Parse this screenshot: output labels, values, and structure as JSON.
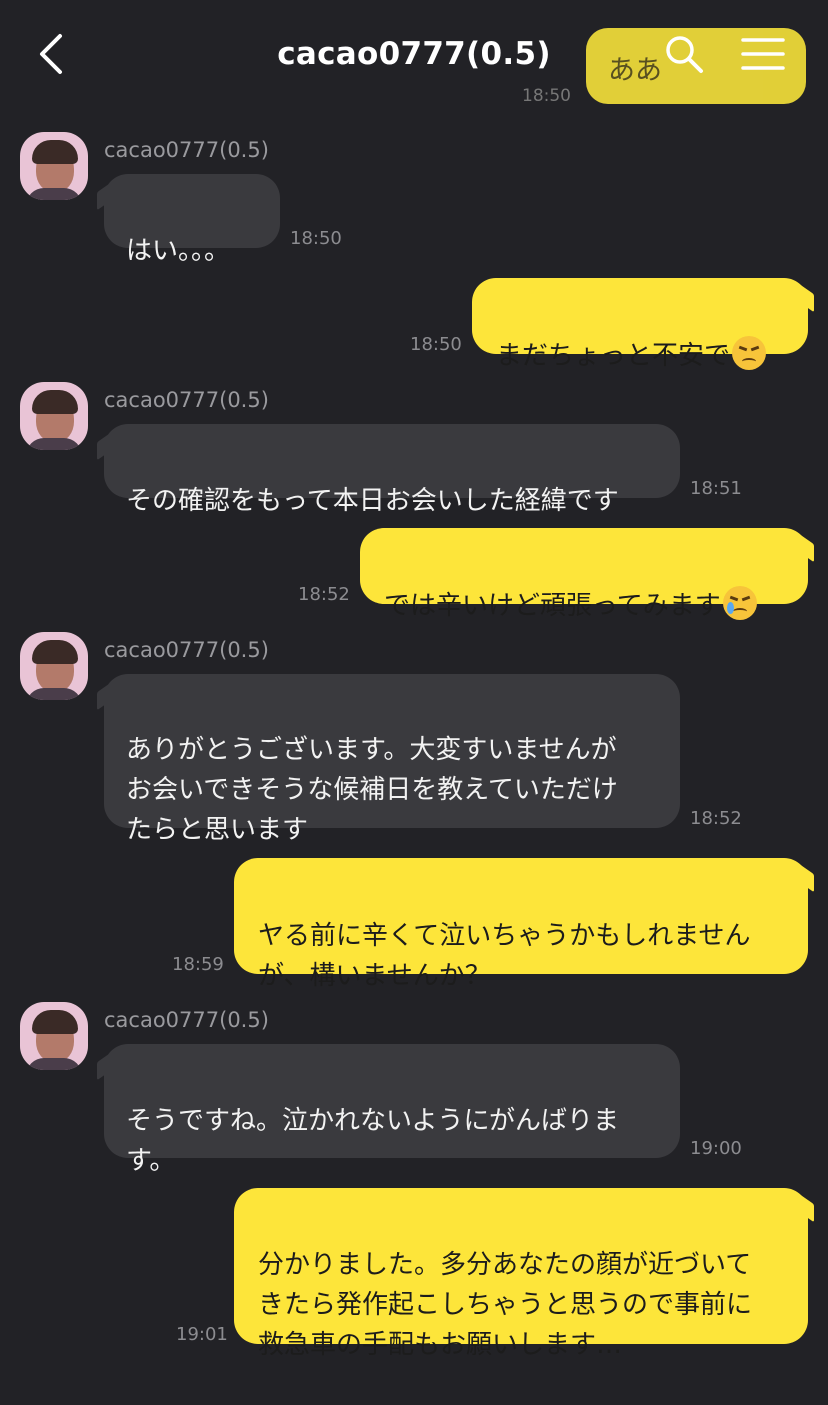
{
  "header": {
    "title": "cacao0777(0.5)",
    "back_icon": "chevron-left-icon",
    "search_icon": "search-icon",
    "menu_icon": "hamburger-menu-icon"
  },
  "peek_message": {
    "text": "ああ",
    "time": "18:50"
  },
  "messages": [
    {
      "side": "in",
      "sender": "cacao0777(0.5)",
      "text": "はい。。。",
      "time": "18:50"
    },
    {
      "side": "out",
      "text": "まだちょっと不安で",
      "emoji": "confounded-face",
      "time": "18:50"
    },
    {
      "side": "in",
      "sender": "cacao0777(0.5)",
      "text": "その確認をもって本日お会いした経緯です",
      "time": "18:51"
    },
    {
      "side": "out",
      "text": "では辛いけど頑張ってみます",
      "emoji": "crying-face",
      "time": "18:52"
    },
    {
      "side": "in",
      "sender": "cacao0777(0.5)",
      "text": "ありがとうございます。大変すいませんが\nお会いできそうな候補日を教えていただけ\nたらと思います",
      "time": "18:52"
    },
    {
      "side": "out",
      "text": "ヤる前に辛くて泣いちゃうかもしれません\nが、構いませんか？",
      "time": "18:59"
    },
    {
      "side": "in",
      "sender": "cacao0777(0.5)",
      "text": "そうですね。泣かれないようにがんばりま\nす。",
      "time": "19:00"
    },
    {
      "side": "out",
      "text": "分かりました。多分あなたの顔が近づいて\nきたら発作起こしちゃうと思うので事前に\n救急車の手配もお願いします…",
      "time": "19:01"
    }
  ],
  "colors": {
    "background": "#222226",
    "incoming_bubble": "#3a3a3e",
    "outgoing_bubble": "#fde53a",
    "timestamp": "#8c8c90"
  }
}
